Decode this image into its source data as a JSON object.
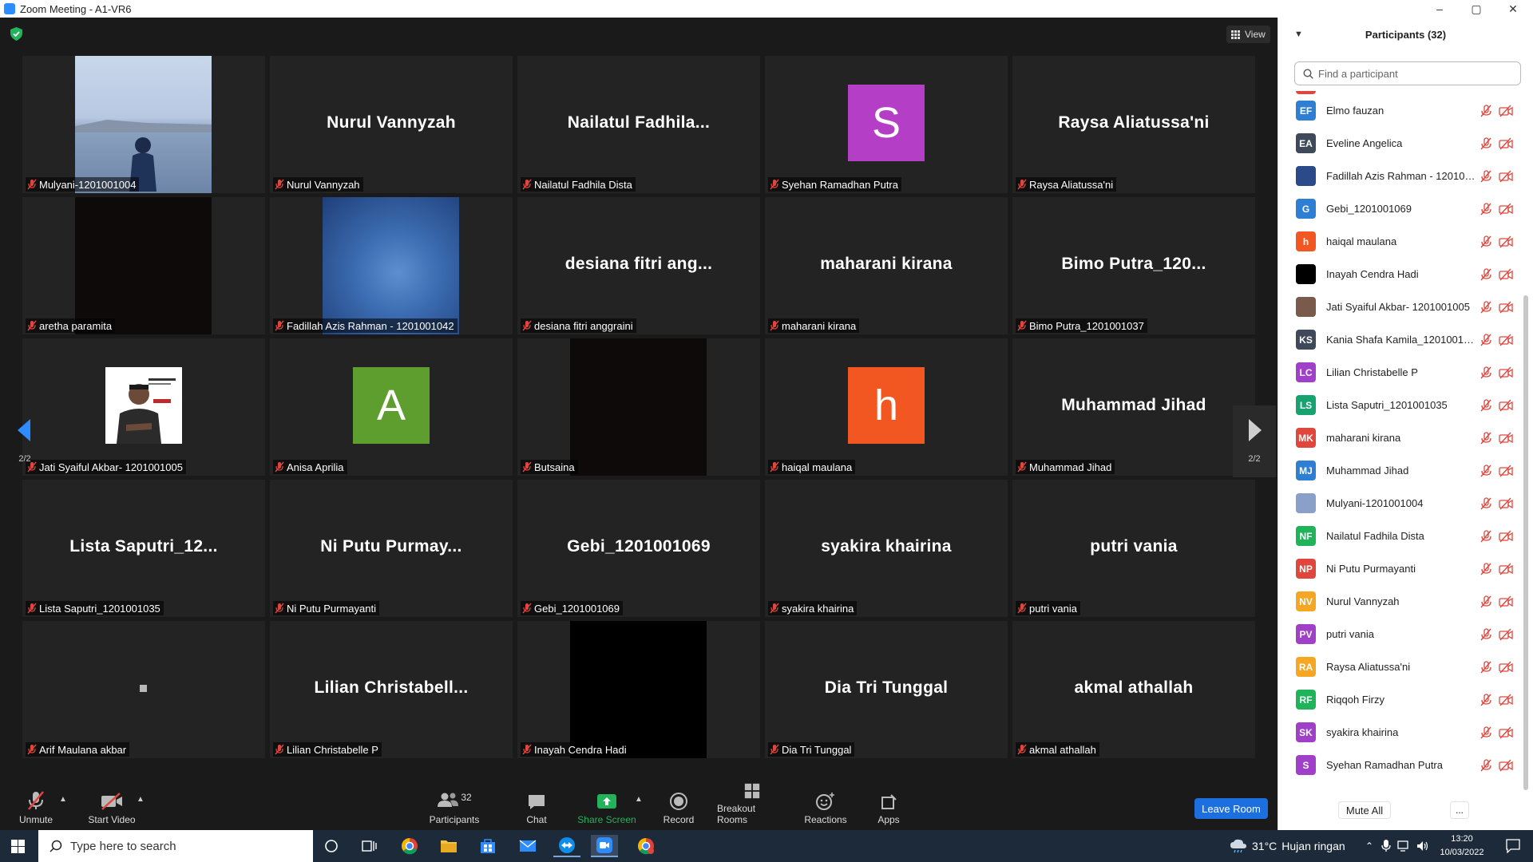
{
  "window": {
    "title": "Zoom Meeting - A1-VR6",
    "controls": [
      "–",
      "▢",
      "✕"
    ]
  },
  "meeting": {
    "view_label": "View",
    "page_indicator_left": "2/2",
    "page_indicator_right": "2/2",
    "tiles": [
      {
        "big_name": "",
        "label": "Mulyani-1201001004",
        "kind": "photo-sea"
      },
      {
        "big_name": "Nurul Vannyzah",
        "label": "Nurul Vannyzah",
        "kind": "name"
      },
      {
        "big_name": "Nailatul  Fadhila...",
        "label": "Nailatul Fadhila Dista",
        "kind": "name"
      },
      {
        "big_name": "",
        "label": "Syehan Ramadhan Putra",
        "kind": "letter",
        "letter": "S",
        "color": "#b43fc6"
      },
      {
        "big_name": "Raysa Aliatussa'ni",
        "label": "Raysa Aliatussa'ni",
        "kind": "name"
      },
      {
        "big_name": "",
        "label": "aretha paramita",
        "kind": "dark-video"
      },
      {
        "big_name": "",
        "label": "Fadillah Azis Rahman - 1201001042",
        "kind": "photo-blue"
      },
      {
        "big_name": "desiana fitri ang...",
        "label": "desiana fitri anggraini",
        "kind": "name"
      },
      {
        "big_name": "maharani kirana",
        "label": "maharani kirana",
        "kind": "name"
      },
      {
        "big_name": "Bimo  Putra_120...",
        "label": "Bimo Putra_1201001037",
        "kind": "name"
      },
      {
        "big_name": "",
        "label": "Jati Syaiful Akbar- 1201001005",
        "kind": "photo-person"
      },
      {
        "big_name": "",
        "label": "Anisa Aprilia",
        "kind": "letter",
        "letter": "A",
        "color": "#5e9e2f"
      },
      {
        "big_name": "",
        "label": "Butsaina",
        "kind": "dark-video"
      },
      {
        "big_name": "",
        "label": "haiqal maulana",
        "kind": "letter",
        "letter": "h",
        "color": "#f25721"
      },
      {
        "big_name": "Muhammad Jihad",
        "label": "Muhammad Jihad",
        "kind": "name"
      },
      {
        "big_name": "Lista  Saputri_12...",
        "label": "Lista Saputri_1201001035",
        "kind": "name"
      },
      {
        "big_name": "Ni Putu  Purmay...",
        "label": "Ni Putu Purmayanti",
        "kind": "name"
      },
      {
        "big_name": "Gebi_1201001069",
        "label": "Gebi_1201001069",
        "kind": "name"
      },
      {
        "big_name": "syakira khairina",
        "label": "syakira khairina",
        "kind": "name"
      },
      {
        "big_name": "putri vania",
        "label": "putri vania",
        "kind": "name"
      },
      {
        "big_name": "",
        "label": "Arif Maulana akbar",
        "kind": "tiny-square"
      },
      {
        "big_name": "Lilian  Christabell...",
        "label": "Lilian Christabelle P",
        "kind": "name"
      },
      {
        "big_name": "",
        "label": "Inayah Cendra Hadi",
        "kind": "black-video"
      },
      {
        "big_name": "Dia Tri Tunggal",
        "label": "Dia Tri Tunggal",
        "kind": "name"
      },
      {
        "big_name": "akmal athallah",
        "label": "akmal athallah",
        "kind": "name"
      }
    ]
  },
  "toolbar": {
    "unmute": "Unmute",
    "start_video": "Start Video",
    "participants": "Participants",
    "participants_count": "32",
    "chat": "Chat",
    "share_screen": "Share Screen",
    "record": "Record",
    "breakout_rooms": "Breakout Rooms",
    "reactions": "Reactions",
    "apps": "Apps",
    "leave_room": "Leave Room"
  },
  "panel": {
    "title": "Participants (32)",
    "search_placeholder": "Find a participant",
    "mute_all": "Mute All",
    "more": "...",
    "participants": [
      {
        "initials": "EF",
        "name": "Elmo fauzan",
        "color": "#2d7fd3"
      },
      {
        "initials": "EA",
        "name": "Eveline Angelica",
        "color": "#3e4a5a"
      },
      {
        "initials": "",
        "name": "Fadillah Azis Rahman - 120100...",
        "color": "#2a4a8a"
      },
      {
        "initials": "G",
        "name": "Gebi_1201001069",
        "color": "#2d7fd3"
      },
      {
        "initials": "h",
        "name": "haiqal maulana",
        "color": "#f25721"
      },
      {
        "initials": "",
        "name": "Inayah Cendra Hadi",
        "color": "#000000"
      },
      {
        "initials": "",
        "name": "Jati Syaiful Akbar- 1201001005",
        "color": "#7a5a4a"
      },
      {
        "initials": "KS",
        "name": "Kania Shafa Kamila_1201001055",
        "color": "#3e4a5a"
      },
      {
        "initials": "LC",
        "name": "Lilian Christabelle P",
        "color": "#a040c8"
      },
      {
        "initials": "LS",
        "name": "Lista Saputri_1201001035",
        "color": "#17a36f"
      },
      {
        "initials": "MK",
        "name": "maharani kirana",
        "color": "#e0463c"
      },
      {
        "initials": "MJ",
        "name": "Muhammad Jihad",
        "color": "#2d7fd3"
      },
      {
        "initials": "",
        "name": "Mulyani-1201001004",
        "color": "#8aa0c8"
      },
      {
        "initials": "NF",
        "name": "Nailatul Fadhila Dista",
        "color": "#1fb35a"
      },
      {
        "initials": "NP",
        "name": "Ni Putu Purmayanti",
        "color": "#e0463c"
      },
      {
        "initials": "NV",
        "name": "Nurul Vannyzah",
        "color": "#f5a623"
      },
      {
        "initials": "PV",
        "name": "putri vania",
        "color": "#a040c8"
      },
      {
        "initials": "RA",
        "name": "Raysa Aliatussa'ni",
        "color": "#f5a623"
      },
      {
        "initials": "RF",
        "name": "Riqqoh Firzy",
        "color": "#1fb35a"
      },
      {
        "initials": "SK",
        "name": "syakira khairina",
        "color": "#a040c8"
      },
      {
        "initials": "S",
        "name": "Syehan Ramadhan Putra",
        "color": "#a040c8"
      }
    ]
  },
  "taskbar": {
    "search_placeholder": "Type here to search",
    "weather_temp": "31°C",
    "weather_text": "Hujan ringan",
    "time": "13:20",
    "date": "10/03/2022"
  },
  "colors": {
    "muted_red": "#e0463c",
    "accent_blue": "#1d6fe0",
    "share_green": "#23b35a"
  }
}
